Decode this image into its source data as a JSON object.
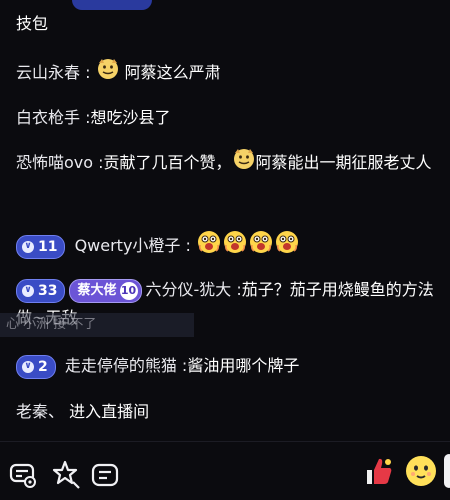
{
  "messages": [
    {
      "user": "",
      "content": "技包"
    },
    {
      "user": "云山永春 :",
      "content": "阿蔡这么严肃",
      "emojis": [
        "doge"
      ]
    },
    {
      "user": "白衣枪手 :",
      "content": "想吃沙县了"
    },
    {
      "user": "恐怖喵ovo :",
      "content_before": "贡献了几百个赞，",
      "content_after": "阿蔡能出一期征服老丈人",
      "emojis": [
        "doge"
      ]
    },
    {
      "level": "11",
      "user": "Qwerty小橙子 :",
      "emojis": [
        "scream",
        "scream",
        "scream",
        "scream"
      ]
    },
    {
      "level": "33",
      "fan_badge": "蔡大佬",
      "fan_level": "10",
      "user": "六分仪-犹大 :",
      "content": "茄子？茄子用烧鳗鱼的方法做~无敌"
    },
    {
      "level": "2",
      "user": "走走停停的熊猫 :",
      "content": "酱油用哪个牌子"
    },
    {
      "user": "老秦、",
      "content": "进入直播间"
    }
  ],
  "overlay_text": "心 小洲 接 不了",
  "toolbar": {
    "icons": [
      "chat-settings-icon",
      "star-effects-icon",
      "message-input-icon"
    ],
    "right_icons": [
      "like-icon",
      "emoji-reaction-icon"
    ]
  },
  "colors": {
    "level_badge": "#3a4cc5",
    "fan_badge": "#6b54d6",
    "background": "#0b0b0f"
  }
}
